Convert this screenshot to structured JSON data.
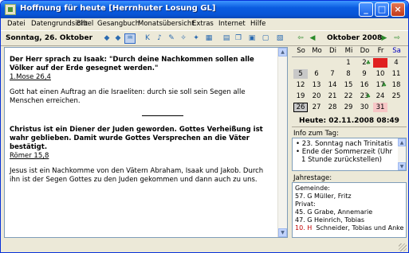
{
  "window": {
    "title": "Hoffnung für heute  [Herrnhuter Losung GL]",
    "minimize": "_",
    "maximize": "□",
    "close": "×"
  },
  "menu": [
    "Datei",
    "Datengrundsicht",
    "Bibel",
    "Gesangbuch",
    "Monatsübersicht",
    "Extras",
    "Internet",
    "Hilfe"
  ],
  "toolbar": {
    "date": "Sonntag, 26. Oktober",
    "month": "Oktober 2008"
  },
  "reading": {
    "verse1": "Der Herr sprach zu Isaak: \"Durch deine Nachkommen sollen alle Völker auf der Erde gesegnet werden.\"",
    "ref1": "1.Mose 26,4",
    "note1": "Gott hat einen Auftrag an die Israeliten: durch sie soll sein Segen alle Menschen erreichen.",
    "verse2": "Christus ist ein Diener der Juden geworden. Gottes Verheißung ist wahr geblieben. Damit wurde Gottes Versprechen an die Väter bestätigt.",
    "ref2": "Römer 15,8",
    "note2": "Jesus ist ein Nachkomme von den Vätern Abraham, Isaak und Jakob. Durch ihn ist der Segen Gottes zu den Juden gekommen und dann auch zu uns."
  },
  "calendar": {
    "weekdays": [
      "So",
      "Mo",
      "Di",
      "Mi",
      "Do",
      "Fr",
      "Sa"
    ],
    "weeks": [
      [
        "",
        "",
        "",
        "1",
        "2",
        "3",
        "4"
      ],
      [
        "5",
        "6",
        "7",
        "8",
        "9",
        "10",
        "11"
      ],
      [
        "12",
        "13",
        "14",
        "15",
        "16",
        "17",
        "18"
      ],
      [
        "19",
        "20",
        "21",
        "22",
        "23",
        "24",
        "25"
      ],
      [
        "26",
        "27",
        "28",
        "29",
        "30",
        "31",
        ""
      ]
    ],
    "today_text": "Heute: 02.11.2008 08:49",
    "colors": {
      "gray": "#c8c8c8",
      "pink": "#f7c6c6",
      "red": "#e02020"
    }
  },
  "info": {
    "label": "Info zum Tag:",
    "items": [
      "23. Sonntag nach Trinitatis",
      "Ende der Sommerzeit (Uhr 1 Stunde zurückstellen)"
    ]
  },
  "jahrestage": {
    "label": "Jahrestage:",
    "rows": [
      {
        "text": "Gemeinde:"
      },
      {
        "text": "57. G   Müller, Fritz"
      },
      {
        "text": "Privat:"
      },
      {
        "text": "45. G   Grabe, Annemarie"
      },
      {
        "text": "47. G   Heinrich, Tobias"
      },
      {
        "num": "10. H",
        "name": "Schneider, Tobias und Anke"
      }
    ]
  }
}
